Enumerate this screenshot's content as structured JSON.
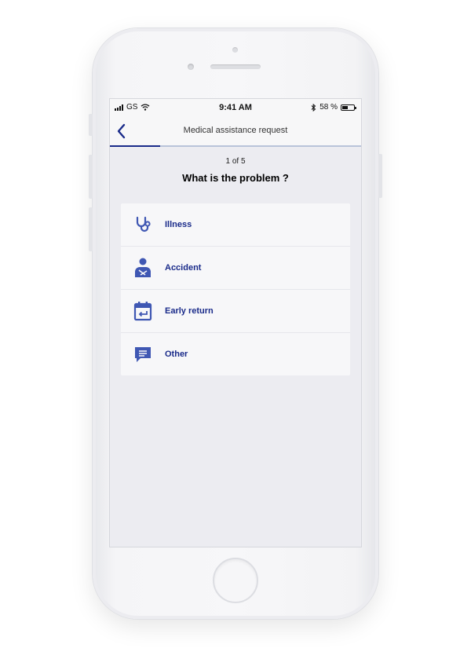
{
  "status_bar": {
    "carrier": "GS",
    "time": "9:41 AM",
    "battery_text": "58 %",
    "battery_level": 0.58
  },
  "nav": {
    "back_icon": "chevron-left-icon",
    "title": "Medical assistance request",
    "progress": 0.2
  },
  "step": "1 of 5",
  "question": "What is the problem ?",
  "options": [
    {
      "label": "Illness",
      "icon": "stethoscope-icon"
    },
    {
      "label": "Accident",
      "icon": "injured-person-icon"
    },
    {
      "label": "Early return",
      "icon": "calendar-return-icon"
    },
    {
      "label": "Other",
      "icon": "chat-bubble-icon"
    }
  ],
  "colors": {
    "accent": "#1a2b8a",
    "icon": "#3f57b3",
    "screen_bg": "#ececf1"
  }
}
